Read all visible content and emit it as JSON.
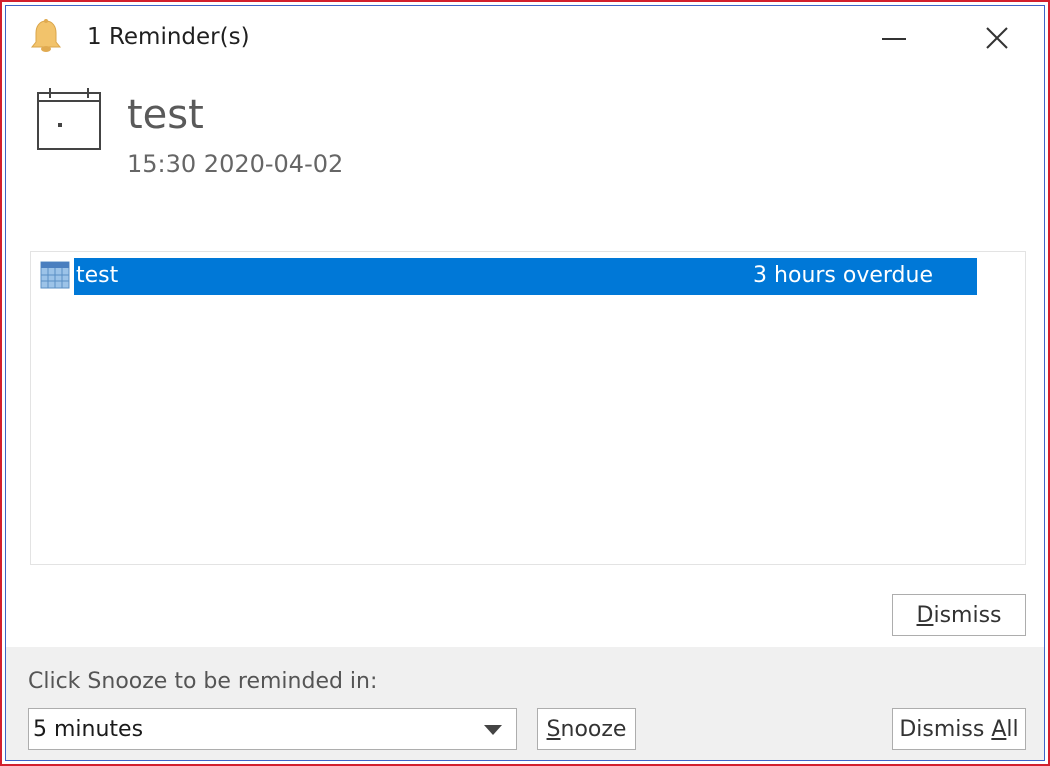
{
  "window": {
    "title": "1 Reminder(s)",
    "colors": {
      "border": "#d2202e",
      "selection": "#0078d7",
      "bell": "#f2c36b"
    }
  },
  "titlebar": {
    "icons": {
      "app": "bell-icon",
      "minimize": "minimize-icon",
      "close": "close-icon"
    }
  },
  "header": {
    "icon": "calendar-icon",
    "subject": "test",
    "time": "15:30 2020-04-02"
  },
  "reminders": [
    {
      "icon": "calendar-grid-icon",
      "subject": "test",
      "due": "3 hours overdue",
      "selected": true
    }
  ],
  "buttons": {
    "dismiss": {
      "mnemonic": "D",
      "rest": "ismiss"
    },
    "snooze": {
      "mnemonic": "S",
      "rest": "nooze"
    },
    "dismiss_all": {
      "before": "Dismiss ",
      "mnemonic": "A",
      "rest": "ll"
    }
  },
  "snooze": {
    "label": "Click Snooze to be reminded in:",
    "selected": "5 minutes"
  }
}
